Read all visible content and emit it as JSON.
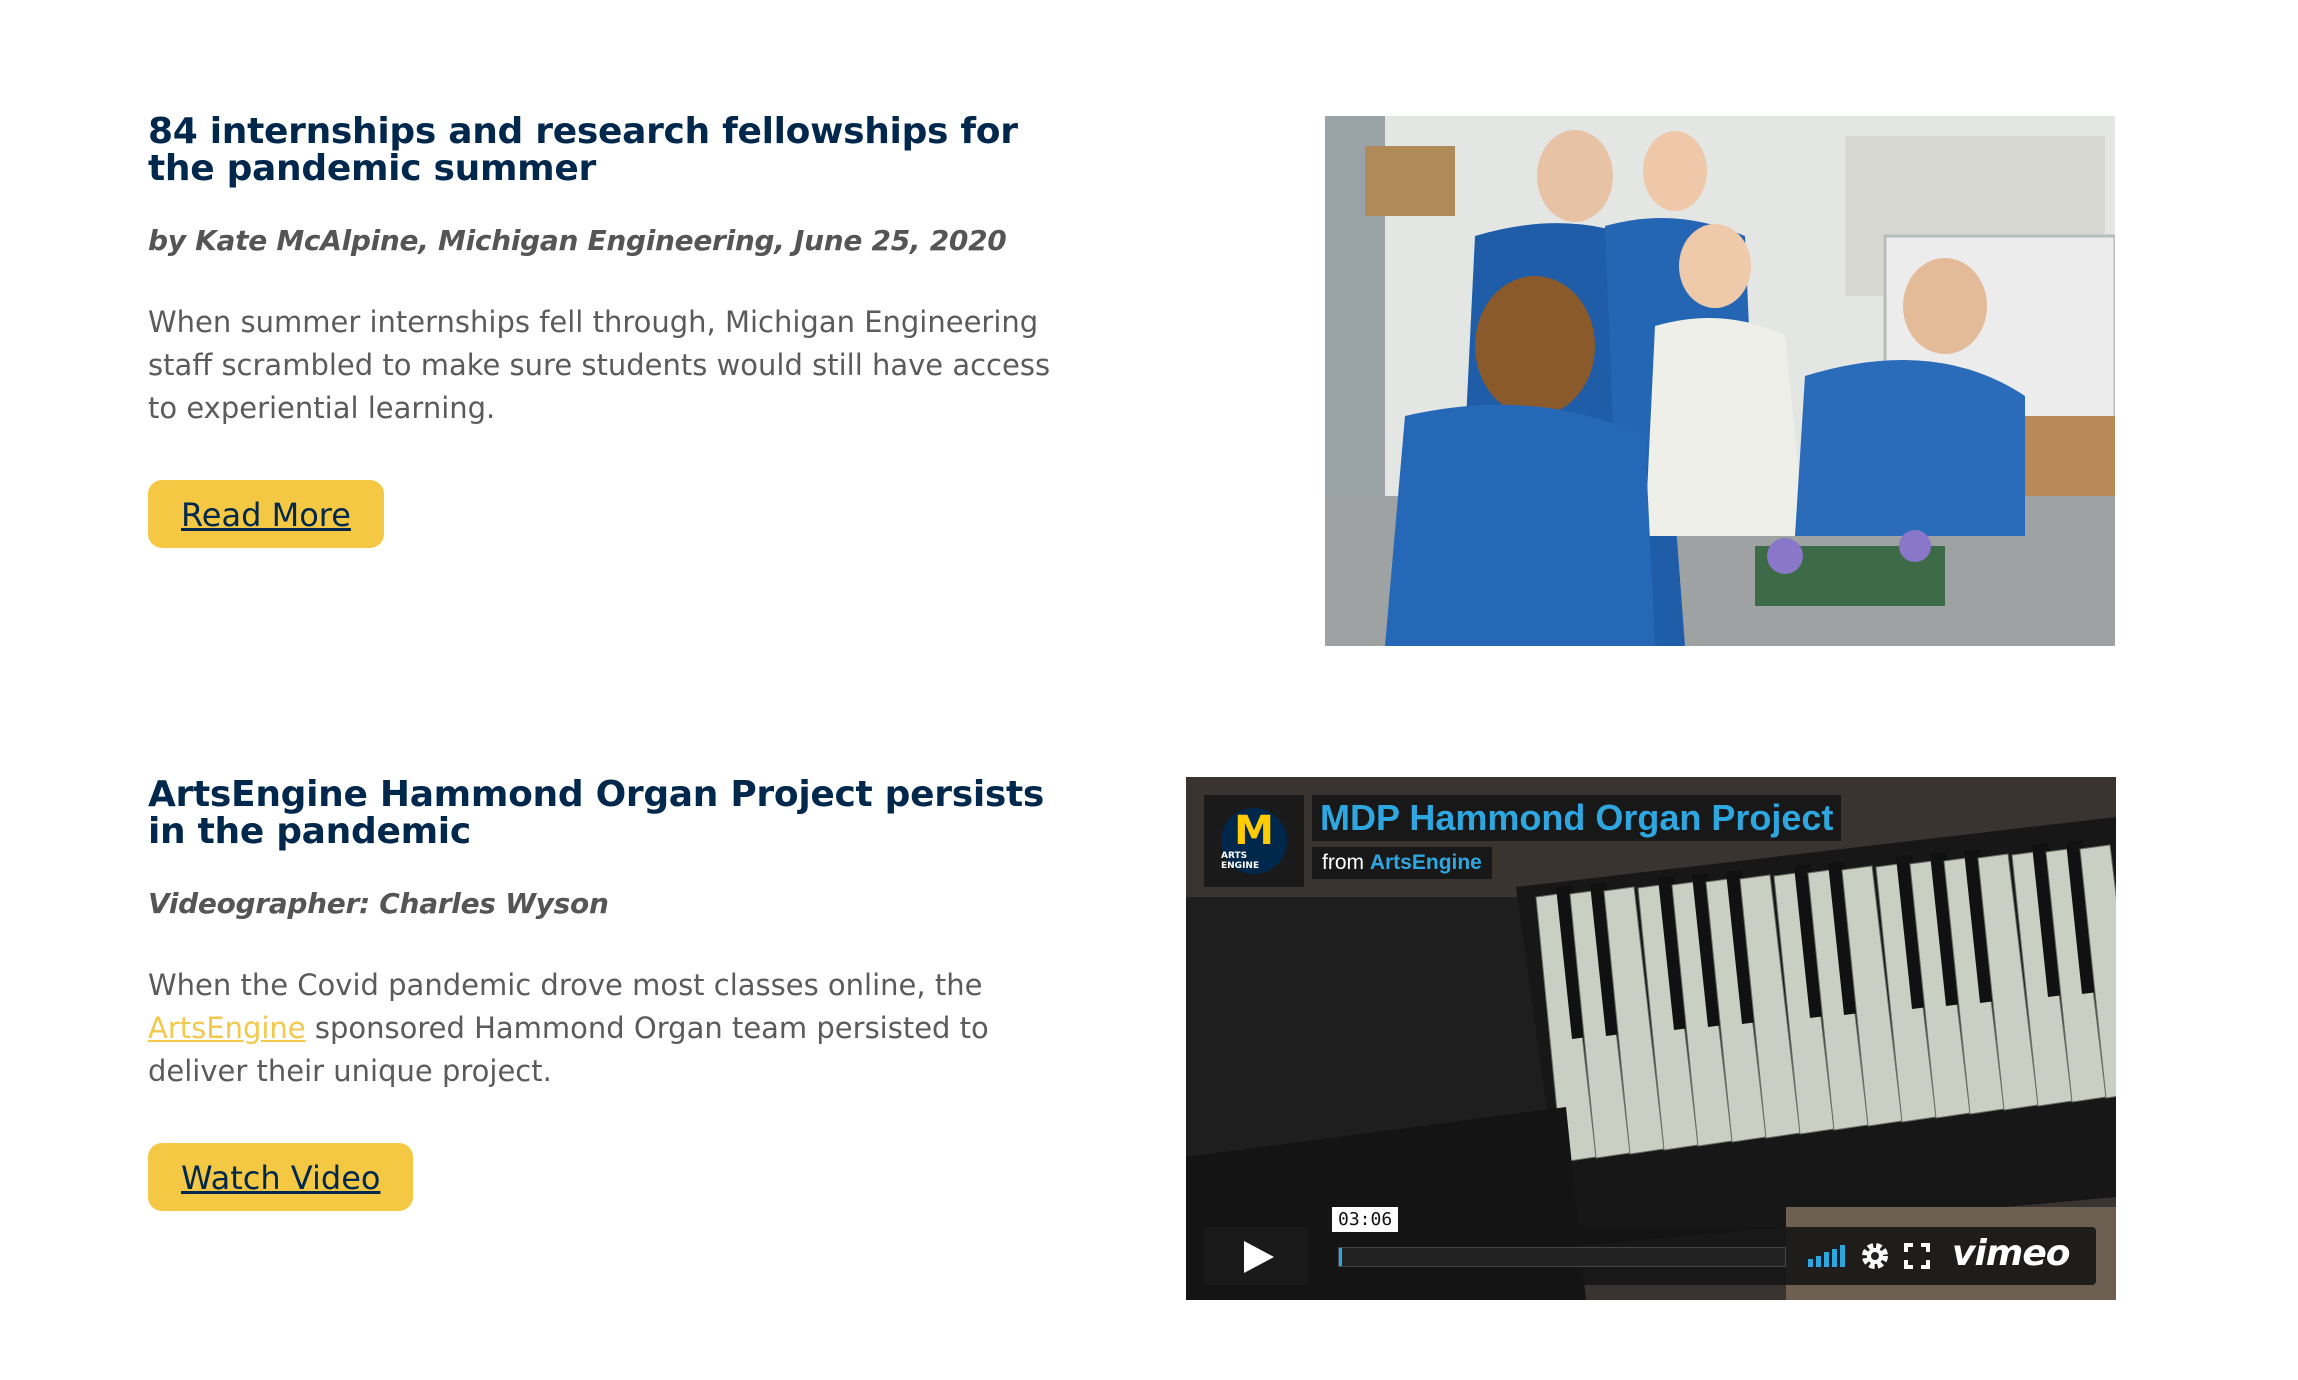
{
  "stories": [
    {
      "title": "84 internships and research fellowships for the pandemic summer",
      "byline": "by Kate McAlpine, Michigan Engineering, June 25, 2020",
      "blurb": "When summer internships fell through, Michigan Engineering staff scrambled to make sure students would still have access to experiential learning.",
      "button": "Read More"
    },
    {
      "title": "ArtsEngine Hammond Organ Project persists in the pandemic",
      "byline": "Videographer: Charles Wyson",
      "blurb_before": "When the Covid pandemic drove most classes online, the ",
      "blurb_link": "ArtsEngine",
      "blurb_after": " sponsored Hammond Organ team persisted to deliver their unique project.",
      "button": "Watch Video"
    }
  ],
  "video": {
    "logo_letter": "M",
    "logo_caption": "ARTS ENGINE",
    "title": "MDP Hammond Organ Project",
    "from_label": "from",
    "from_channel": "ArtsEngine",
    "duration": "03:06",
    "brand": "vimeo",
    "progress": 0.0,
    "colors": {
      "accent": "#2ea7e0"
    }
  },
  "colors": {
    "heading": "#00274c",
    "button": "#f4c842",
    "link": "#f2c94c"
  },
  "icons": [
    "play-icon",
    "volume-icon",
    "settings-gear-icon",
    "fullscreen-icon"
  ]
}
